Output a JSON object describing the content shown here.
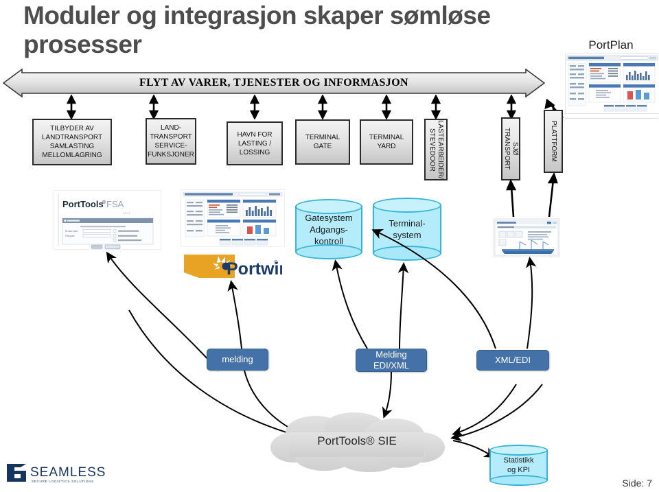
{
  "slide": {
    "title": "Moduler og integrasjon skaper sømløse prosesser",
    "page_label": "Side: 7"
  },
  "portplan": {
    "label": "PortPlan"
  },
  "flow_arrow": {
    "label": "FLYT AV VARER, TJENESTER OG INFORMASJON"
  },
  "role_boxes": [
    {
      "label": "TILBYDER AV LANDTRANSPORT SAMLASTING MELLOMLAGRING",
      "lines": [
        "TILBYDER AV",
        "LANDTRANSPORT",
        "SAMLASTING",
        "MELLOMLAGRING"
      ],
      "orientation": "horizontal"
    },
    {
      "label": "LAND-TRANSPORT SERVICE-FUNKSJONER",
      "lines": [
        "LAND-",
        "TRANSPORT",
        "SERVICE-",
        "FUNKSJONER"
      ],
      "orientation": "horizontal"
    },
    {
      "label": "HAVN FOR LASTING / LOSSING",
      "lines": [
        "HAVN FOR",
        "LASTING /",
        "LOSSING"
      ],
      "orientation": "horizontal"
    },
    {
      "label": "TERMINAL GATE",
      "lines": [
        "TERMINAL",
        "GATE"
      ],
      "orientation": "horizontal"
    },
    {
      "label": "TERMINAL YARD",
      "lines": [
        "TERMINAL",
        "YARD"
      ],
      "orientation": "horizontal"
    },
    {
      "label": "LASTEARBEIDER/ STEVEDOOR",
      "lines": [
        "LASTEARBEIDER/",
        "STEVEDOOR"
      ],
      "orientation": "vertical"
    },
    {
      "label": "SJØ TRANSPORT",
      "lines": [
        "SJØ TRANSPORT"
      ],
      "orientation": "vertical"
    },
    {
      "label": "PLATTFORM",
      "lines": [
        "PLATTFORM"
      ],
      "orientation": "vertical"
    }
  ],
  "databases": [
    {
      "label": "Gatesystem Adgangs-kontroll",
      "lines": [
        "Gatesystem",
        "Adgangs-",
        "kontroll"
      ]
    },
    {
      "label": "Terminal-system",
      "lines": [
        "Terminal-",
        "system"
      ]
    }
  ],
  "statistics_db": {
    "lines": [
      "Statistikk",
      "og KPI"
    ],
    "label": "Statistikk og KPI"
  },
  "message_boxes": [
    {
      "label": "melding",
      "lines": [
        "melding"
      ]
    },
    {
      "label": "Melding EDI/XML",
      "lines": [
        "Melding",
        "EDI/XML"
      ]
    },
    {
      "label": "XML/EDI",
      "lines": [
        "XML/EDI"
      ]
    }
  ],
  "cloud": {
    "label": "PortTools® SIE"
  },
  "products": {
    "porttools_fsa": {
      "brand": "PortTools®",
      "product": "FSA"
    },
    "portwin": {
      "brand": "Portwin",
      "registered": "®"
    }
  },
  "logo": {
    "name": "SEAMLESS",
    "tagline": "SECURE LOGISTICS SOLUTIONS"
  },
  "colors": {
    "title_gray": "#4d4d4d",
    "box_border": "#2b2b2b",
    "cyl_fill": "#b4ecfb",
    "cyl_stroke": "#36b3d8",
    "msg_blue": "#4472a8",
    "cloud_gray": "#d9d9d9",
    "logo_navy": "#16355e",
    "portwin_orange": "#e8a224"
  }
}
